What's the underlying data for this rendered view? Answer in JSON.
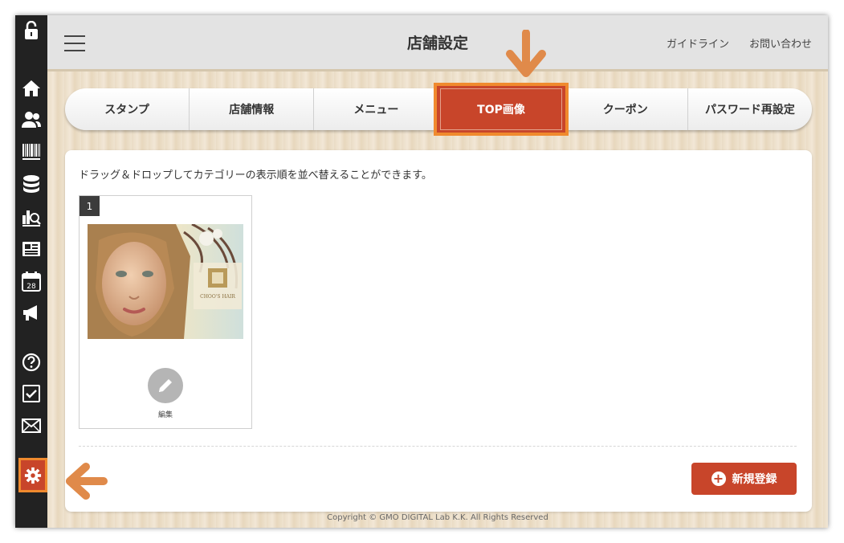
{
  "header": {
    "title": "店舗設定",
    "links": [
      "ガイドライン",
      "お問い合わせ"
    ]
  },
  "sidebar": {
    "icons": [
      "unlock-icon",
      "home-icon",
      "users-icon",
      "barcode-icon",
      "database-icon",
      "analytics-icon",
      "news-icon",
      "calendar-icon",
      "megaphone-icon",
      "help-icon",
      "checkbox-icon",
      "mail-icon",
      "gear-icon"
    ],
    "calendar_day": "28"
  },
  "tabs": {
    "stamp": "スタンプ",
    "store_info": "店舗情報",
    "menu": "メニュー",
    "top_image": "TOP画像",
    "coupon": "クーポン",
    "password": "パスワード再設定"
  },
  "main": {
    "instruction": "ドラッグ＆ドロップしてカテゴリーの表示順を並べ替えることができます。",
    "card": {
      "number": "1",
      "edit_label": "編集",
      "logo_text": "CHOO'S HAIR"
    },
    "new_button": "新規登録"
  },
  "footer": {
    "copyright": "Copyright © GMO DIGITAL Lab K.K. All Rights Reserved"
  },
  "colors": {
    "accent": "#c8452a",
    "highlight": "#f08a2e",
    "sidebar": "#222222"
  }
}
